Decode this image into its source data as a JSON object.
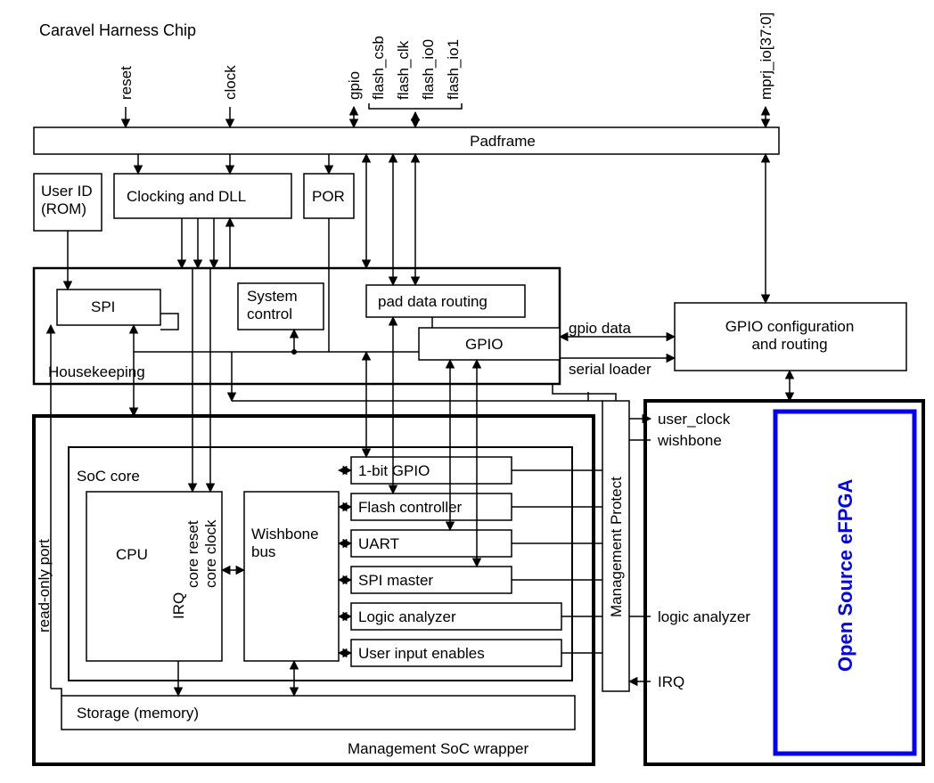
{
  "title": "Caravel Harness Chip",
  "top_signals": {
    "reset": "reset",
    "clock": "clock",
    "gpio": "gpio",
    "flash_csb": "flash_csb",
    "flash_clk": "flash_clk",
    "flash_io0": "flash_io0",
    "flash_io1": "flash_io1",
    "mprj_io": "mprj_io[37:0]"
  },
  "blocks": {
    "padframe": "Padframe",
    "user_id": "User ID\n(ROM)",
    "clocking": "Clocking and DLL",
    "por": "POR",
    "spi": "SPI",
    "system_control": "System\ncontrol",
    "pad_data_routing": "pad data routing",
    "gpio": "GPIO",
    "housekeeping_lbl": "Housekeeping",
    "gpio_config": "GPIO configuration\nand routing",
    "soc_core_lbl": "SoC core",
    "cpu": "CPU",
    "wishbone_bus": "Wishbone\nbus",
    "onebit_gpio": "1-bit GPIO",
    "flash_ctrl": "Flash controller",
    "uart": "UART",
    "spi_master": "SPI master",
    "logic_analyzer": "Logic analyzer",
    "user_input_enables": "User input enables",
    "storage": "Storage (memory)",
    "mgmt_soc_wrapper": "Management SoC wrapper",
    "mgmt_protect": "Management Protect",
    "efpga": "Open Source eFPGA"
  },
  "side_labels": {
    "read_only_port": "read-only port",
    "core_reset": "core reset",
    "core_clock": "core clock",
    "irq": "IRQ",
    "gpio_data": "gpio data",
    "serial_loader": "serial loader",
    "user_clock": "user_clock",
    "wishbone": "wishbone",
    "logic_analyzer_sig": "logic analyzer",
    "irq_sig": "IRQ"
  }
}
